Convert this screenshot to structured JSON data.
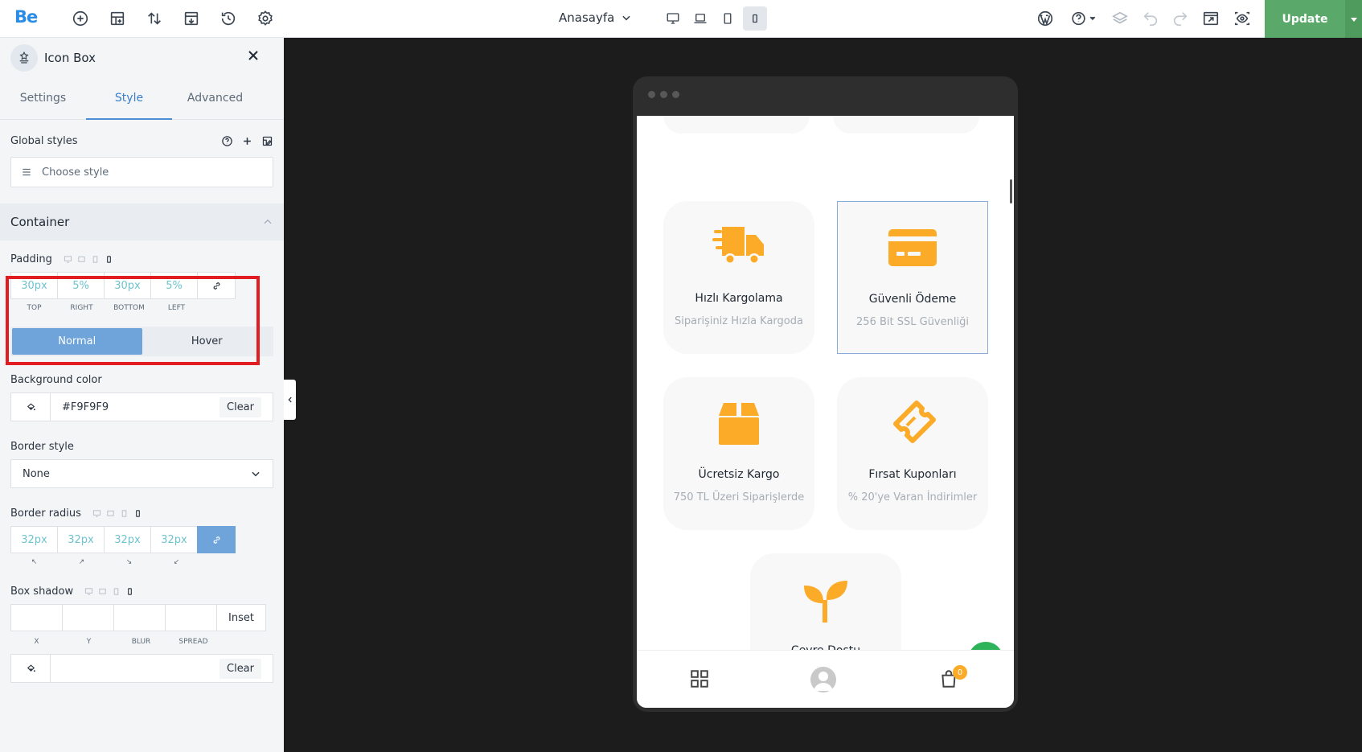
{
  "topbar": {
    "logo": "Be",
    "page_name": "Anasayfa",
    "update_label": "Update"
  },
  "panel": {
    "title": "Icon Box",
    "tabs": [
      {
        "label": "Settings"
      },
      {
        "label": "Style"
      },
      {
        "label": "Advanced"
      }
    ],
    "global_styles": {
      "label": "Global styles",
      "placeholder": "Choose style"
    },
    "container": {
      "label": "Container",
      "padding": {
        "label": "Padding",
        "values": [
          "30px",
          "5%",
          "30px",
          "5%"
        ],
        "labels": [
          "TOP",
          "RIGHT",
          "BOTTOM",
          "LEFT"
        ]
      },
      "state_tabs": [
        "Normal",
        "Hover"
      ],
      "background_color": {
        "label": "Background color",
        "value": "#F9F9F9",
        "clear": "Clear"
      },
      "border_style": {
        "label": "Border style",
        "value": "None"
      },
      "border_radius": {
        "label": "Border radius",
        "values": [
          "32px",
          "32px",
          "32px",
          "32px"
        ]
      },
      "box_shadow": {
        "label": "Box shadow",
        "inset": "Inset",
        "labels": [
          "X",
          "Y",
          "BLUR",
          "SPREAD"
        ],
        "clear": "Clear"
      }
    }
  },
  "preview": {
    "cards": [
      {
        "title": "Hızlı Kargolama",
        "subtitle": "Siparişiniz Hızla Kargoda",
        "icon": "truck-icon"
      },
      {
        "title": "Güvenli Ödeme",
        "subtitle": "256 Bit SSL Güvenliği",
        "icon": "credit-card-icon"
      },
      {
        "title": "Ücretsiz Kargo",
        "subtitle": "750 TL Üzeri Siparişlerde",
        "icon": "box-icon"
      },
      {
        "title": "Fırsat Kuponları",
        "subtitle": "% 20'ye Varan İndirimler",
        "icon": "ticket-icon"
      },
      {
        "title": "Çevre Dostu",
        "icon": "sprout-icon"
      }
    ],
    "cart_count": "0"
  },
  "colors": {
    "accent": "#6ea4da",
    "icon_orange": "#fbab28",
    "update_green": "#5aa96a",
    "highlight_red": "#e21d22"
  }
}
